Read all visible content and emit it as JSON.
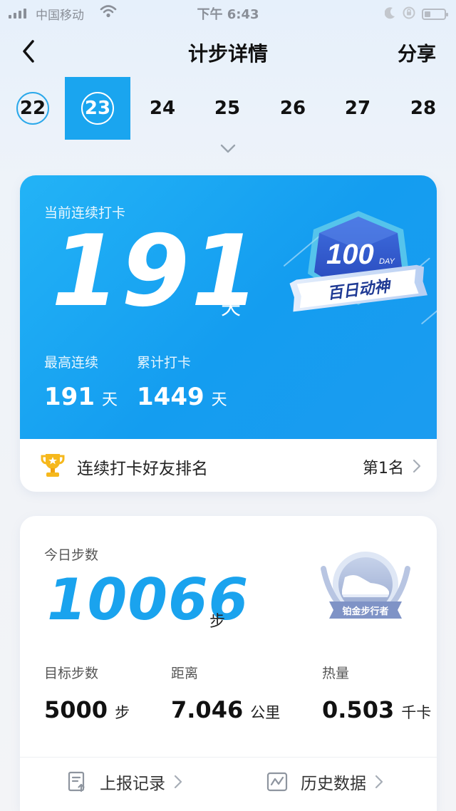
{
  "status_bar": {
    "carrier": "中国移动",
    "time": "下午 6:43",
    "icons": [
      "signal-icon",
      "wifi-icon",
      "moon-icon",
      "lock-rotation-icon",
      "battery-icon"
    ]
  },
  "header": {
    "title": "计步详情",
    "share_label": "分享",
    "back_icon": "back-arrow-icon"
  },
  "date_strip": {
    "items": [
      {
        "label": "22",
        "state": "ringed"
      },
      {
        "label": "23",
        "state": "selected"
      },
      {
        "label": "24",
        "state": "normal"
      },
      {
        "label": "25",
        "state": "normal"
      },
      {
        "label": "26",
        "state": "normal"
      },
      {
        "label": "27",
        "state": "normal"
      },
      {
        "label": "28",
        "state": "normal"
      }
    ],
    "expand_icon": "chevron-down-icon"
  },
  "streak_card": {
    "label": "当前连续打卡",
    "value": "191",
    "unit": "天",
    "max_streak": {
      "label": "最高连续",
      "value": "191",
      "unit": "天"
    },
    "total_checkins": {
      "label": "累计打卡",
      "value": "1449",
      "unit": "天"
    },
    "badge": {
      "number": "100",
      "suffix": "DAY",
      "ribbon": "百日动神"
    },
    "ranking": {
      "label": "连续打卡好友排名",
      "value": "第1名",
      "icon": "trophy-icon"
    }
  },
  "steps_card": {
    "label": "今日步数",
    "value": "10066",
    "unit": "步",
    "badge": {
      "ribbon": "铂金步行者"
    },
    "metrics": [
      {
        "label": "目标步数",
        "value": "5000",
        "unit": "步"
      },
      {
        "label": "距离",
        "value": "7.046",
        "unit": "公里"
      },
      {
        "label": "热量",
        "value": "0.503",
        "unit": "千卡"
      }
    ],
    "links": [
      {
        "label": "上报记录",
        "icon": "report-doc-icon"
      },
      {
        "label": "历史数据",
        "icon": "history-chart-icon"
      }
    ]
  },
  "colors": {
    "accent": "#1aa5ef",
    "card_gradient_start": "#23b3f6",
    "card_gradient_end": "#149df0",
    "steps_value": "#1aa3ee"
  }
}
